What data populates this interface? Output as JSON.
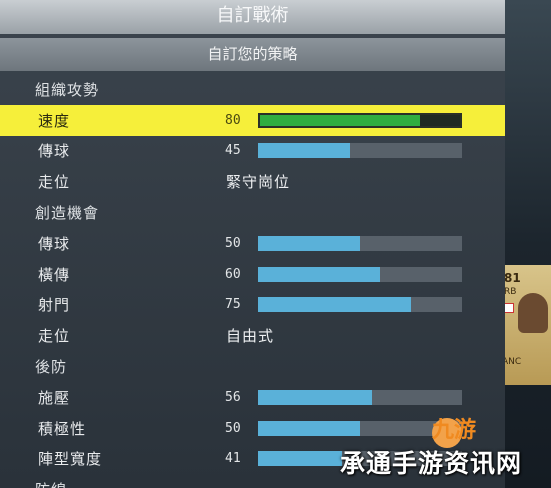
{
  "header": {
    "title": "自訂戰術",
    "subtitle": "自訂您的策略"
  },
  "rows": [
    {
      "kind": "section",
      "label": "組織攻勢"
    },
    {
      "kind": "slider",
      "label": "速度",
      "value": "80",
      "fill": 0.8,
      "selected": true
    },
    {
      "kind": "slider",
      "label": "傳球",
      "value": "45",
      "fill": 0.45
    },
    {
      "kind": "text",
      "label": "走位",
      "text": "緊守崗位"
    },
    {
      "kind": "section",
      "label": "創造機會"
    },
    {
      "kind": "slider",
      "label": "傳球",
      "value": "50",
      "fill": 0.5
    },
    {
      "kind": "slider",
      "label": "橫傳",
      "value": "60",
      "fill": 0.6
    },
    {
      "kind": "slider",
      "label": "射門",
      "value": "75",
      "fill": 0.75
    },
    {
      "kind": "text",
      "label": "走位",
      "text": "自由式"
    },
    {
      "kind": "section",
      "label": "後防"
    },
    {
      "kind": "slider",
      "label": "施壓",
      "value": "56",
      "fill": 0.56
    },
    {
      "kind": "slider",
      "label": "積極性",
      "value": "50",
      "fill": 0.5
    },
    {
      "kind": "slider",
      "label": "陣型寬度",
      "value": "41",
      "fill": 0.41
    },
    {
      "kind": "section",
      "label": "防線"
    }
  ],
  "player_card": {
    "rating": "81",
    "position": "RB",
    "name": "ANC"
  },
  "watermark": {
    "text": "承通手游资讯网",
    "logo_text": "九游"
  },
  "colors": {
    "selected_bg": "#f6ef3a",
    "selected_fill": "#30ad40",
    "bar_fill": "#5ab1d9",
    "track": "#58616a"
  }
}
